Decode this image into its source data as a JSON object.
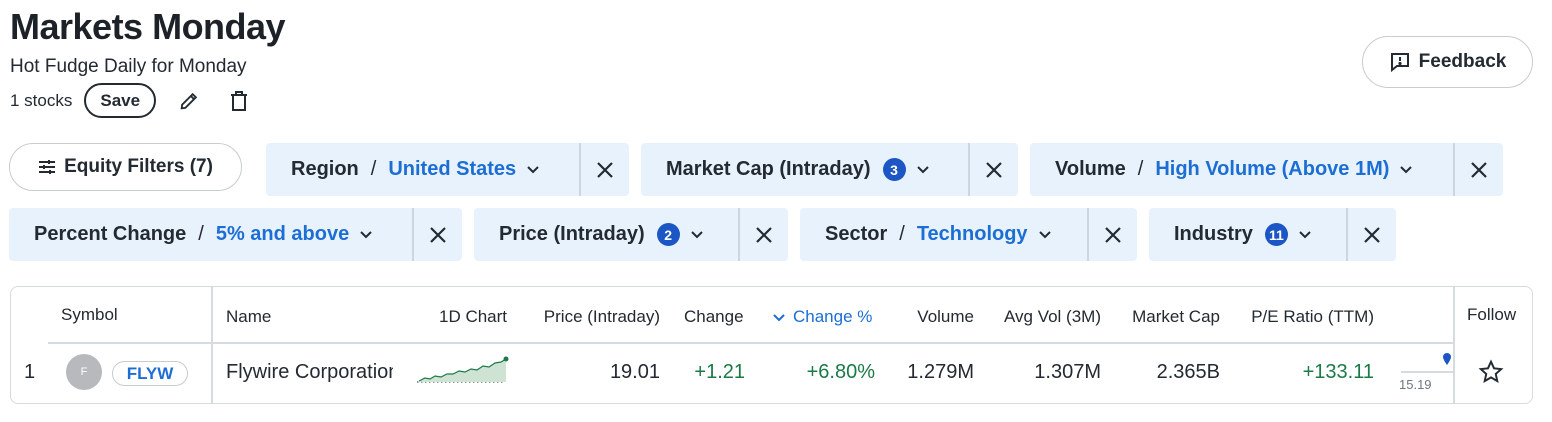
{
  "header": {
    "title": "Markets Monday",
    "subtitle": "Hot Fudge Daily for Monday",
    "stock_count": "1 stocks",
    "save_label": "Save",
    "feedback_label": "Feedback"
  },
  "filters": {
    "equity_label": "Equity Filters (7)",
    "chips": [
      {
        "name": "Region",
        "value": "United States"
      },
      {
        "name": "Market Cap (Intraday)",
        "badge": "3"
      },
      {
        "name": "Volume",
        "value": "High Volume (Above 1M)"
      },
      {
        "name": "Percent Change",
        "value": "5% and above"
      },
      {
        "name": "Price (Intraday)",
        "badge": "2"
      },
      {
        "name": "Sector",
        "value": "Technology"
      },
      {
        "name": "Industry",
        "badge": "11"
      }
    ]
  },
  "table": {
    "columns": [
      "Symbol",
      "Name",
      "1D Chart",
      "Price (Intraday)",
      "Change",
      "Change %",
      "Volume",
      "Avg Vol (3M)",
      "Market Cap",
      "P/E Ratio (TTM)",
      "Follow"
    ],
    "sorted_column": "Change %",
    "rows": [
      {
        "index": "1",
        "logo_letter": "F",
        "symbol": "FLYW",
        "name": "Flywire Corporation",
        "price": "19.01",
        "change": "+1.21",
        "change_pct": "+6.80%",
        "volume": "1.279M",
        "avg_vol": "1.307M",
        "market_cap": "2.365B",
        "pe_ratio": "+133.11",
        "range_low": "15.19"
      }
    ]
  },
  "colors": {
    "accent": "#1c6ed4",
    "badge": "#1c55c4",
    "positive": "#1b7a47",
    "chip_bg": "#e8f2fc"
  },
  "icons": [
    "pencil-icon",
    "trash-icon",
    "feedback-icon",
    "sliders-icon",
    "chevron-down-icon",
    "close-icon",
    "sort-down-icon",
    "map-pin-icon",
    "star-icon"
  ]
}
